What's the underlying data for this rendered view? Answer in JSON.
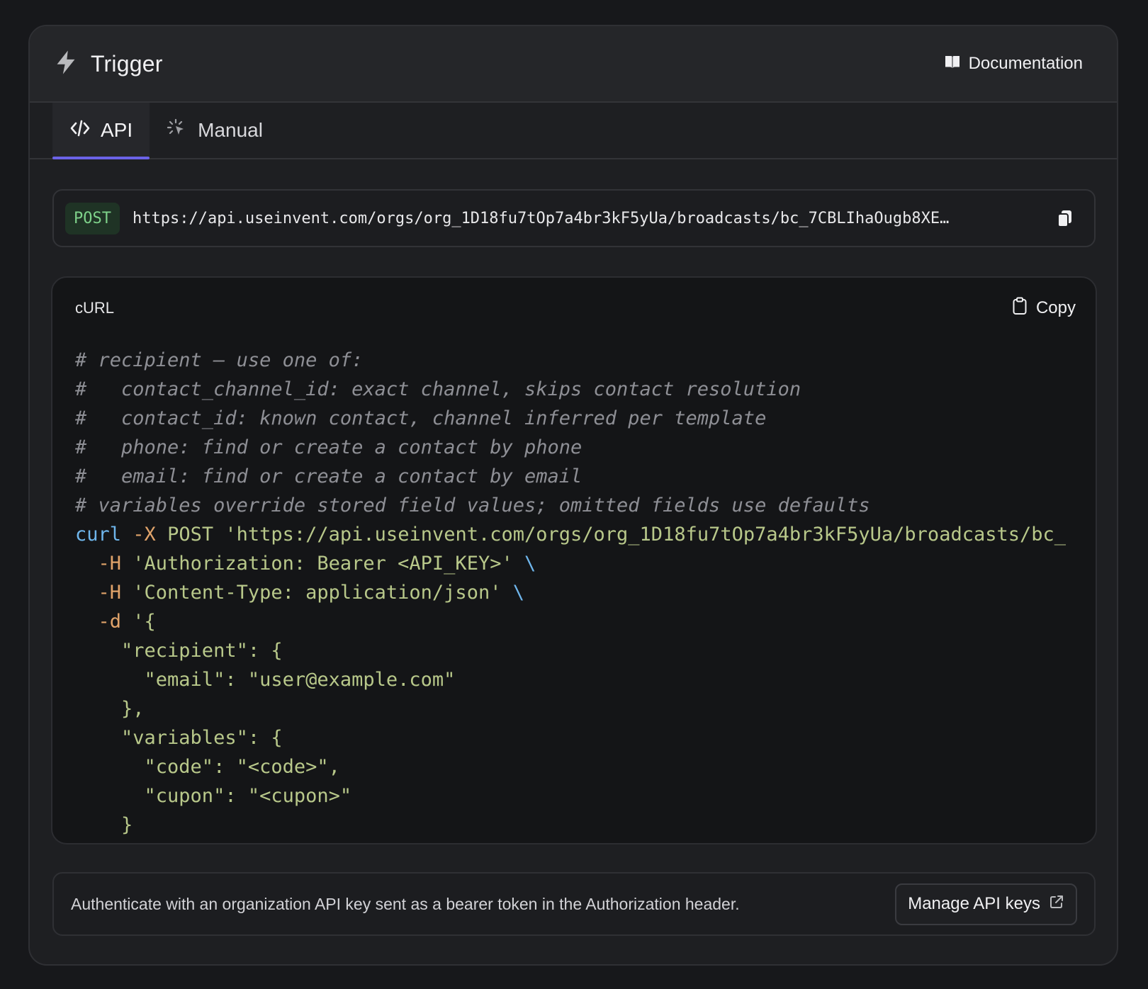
{
  "header": {
    "title": "Trigger",
    "icon": "lightning-icon",
    "doc_label": "Documentation",
    "doc_icon": "book-icon"
  },
  "tabs": [
    {
      "label": "API",
      "icon": "code-icon",
      "active": true
    },
    {
      "label": "Manual",
      "icon": "cursor-click-icon",
      "active": false
    }
  ],
  "endpoint": {
    "method": "POST",
    "url": "https://api.useinvent.com/orgs/org_1D18fu7tOp7a4br3kF5yUa/broadcasts/bc_7CBLIhaOugb8XE…",
    "copy_icon": "copy-icon"
  },
  "code": {
    "language": "cURL",
    "copy_label": "Copy",
    "comments": [
      "# recipient — use one of:",
      "#   contact_channel_id: exact channel, skips contact resolution",
      "#   contact_id: known contact, channel inferred per template",
      "#   phone: find or create a contact by phone",
      "#   email: find or create a contact by email",
      "# variables override stored field values; omitted fields use defaults"
    ],
    "curl_cmd": "curl",
    "curl_flag": "-X",
    "curl_method": " POST ",
    "curl_url": "'https://api.useinvent.com/orgs/org_1D18fu7tOp7a4br3kF5yUa/broadcasts/bc_",
    "h1_flag": "  -H",
    "h1_value": " 'Authorization: Bearer <API_KEY>'",
    "h2_flag": "  -H",
    "h2_value": " 'Content-Type: application/json'",
    "backslash": " \\",
    "d_flag": "  -d",
    "d_open": " '{",
    "body_lines": [
      "    \"recipient\": {",
      "      \"email\": \"user@example.com\"",
      "    },",
      "    \"variables\": {",
      "      \"code\": \"<code>\",",
      "      \"cupon\": \"<cupon>\"",
      "    }"
    ]
  },
  "auth": {
    "text": "Authenticate with an organization API key sent as a bearer token in the Authorization header.",
    "manage_label": "Manage API keys",
    "manage_icon": "external-link-icon"
  }
}
